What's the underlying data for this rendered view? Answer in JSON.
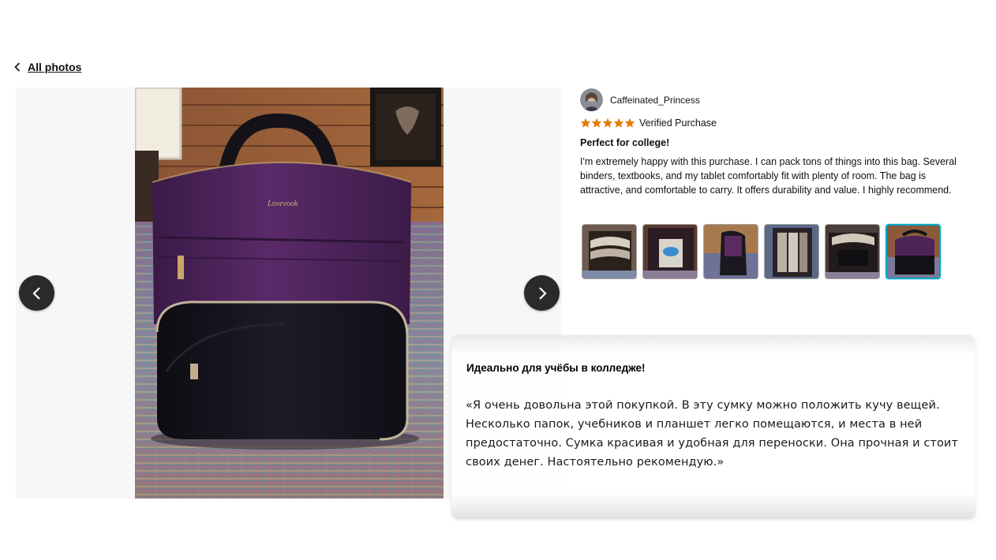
{
  "nav": {
    "back_label": "All photos"
  },
  "review": {
    "reviewer_name": "Caffeinated_Princess",
    "rating": 5,
    "rating_max": 5,
    "verified_label": "Verified Purchase",
    "title": "Perfect for college!",
    "body": "I'm extremely happy with this purchase. I can pack tons of things into this bag. Several binders, textbooks, and my tablet comfortably fit with plenty of room. The bag is attractive, and comfortable to carry. It offers durability and value. I highly recommend."
  },
  "gallery": {
    "thumbnail_count": 6,
    "active_thumbnail": 6,
    "photo_brand_text": "Lovevook"
  },
  "translation": {
    "title": "Идеально для учёбы в колледже!",
    "body": "«Я очень довольна этой покупкой. В эту сумку можно положить кучу вещей. Несколько папок, учебников и планшет легко помещаются, и места в ней предостаточно. Сумка красивая и удобная для переноски. Она прочная и стоит своих денег. Настоятельно рекомендую.»"
  },
  "colors": {
    "star": "#e67a00",
    "active_thumb_border": "#00a8c8",
    "nav_button": "#2a2a2a",
    "bag_purple": "#4a2257",
    "bag_black": "#15131c"
  }
}
